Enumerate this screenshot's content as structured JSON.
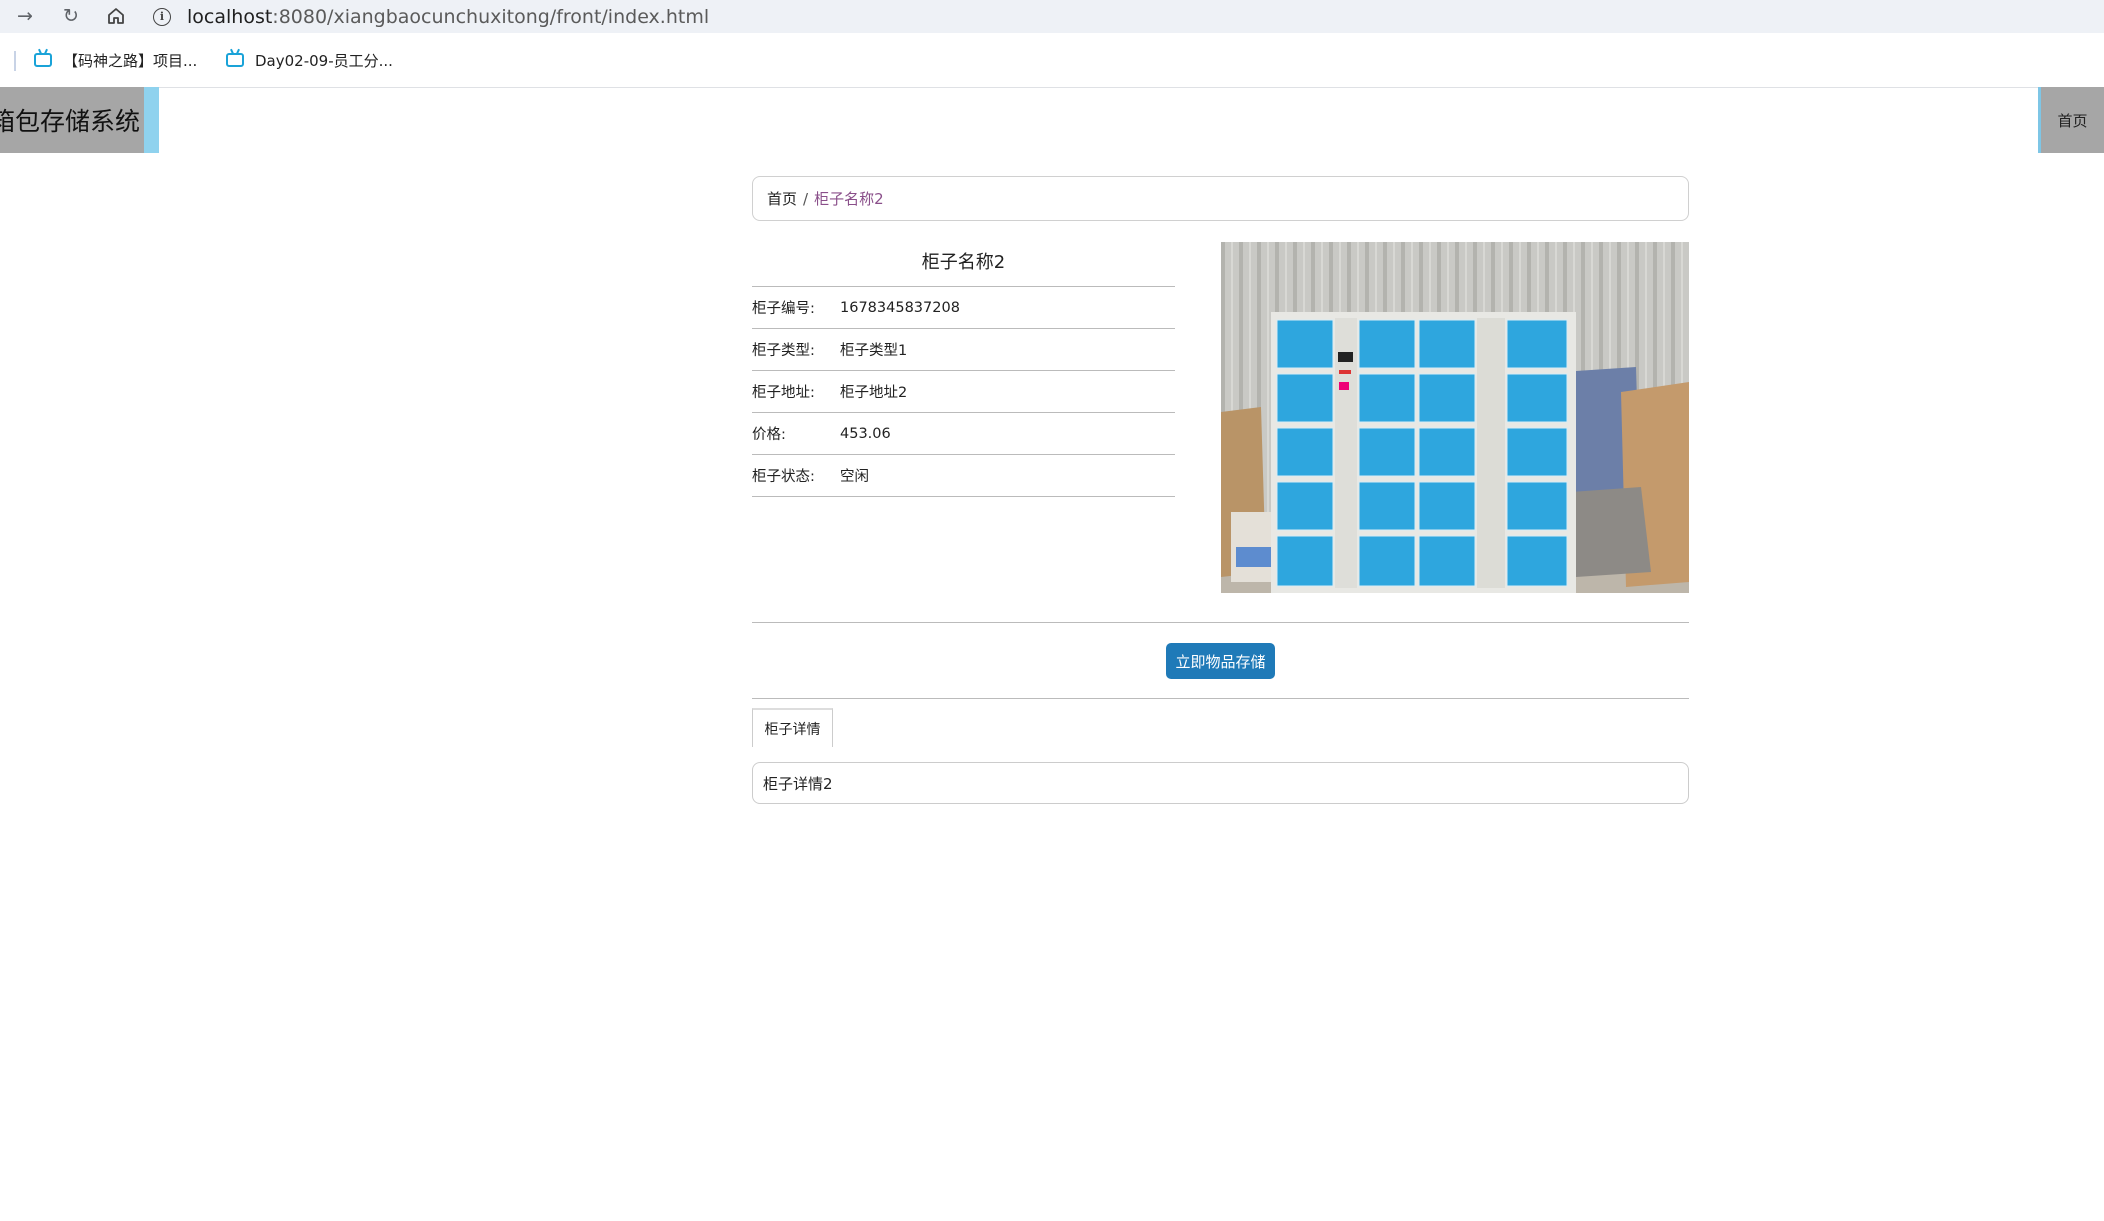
{
  "browser": {
    "url_host": "localhost",
    "url_path": ":8080/xiangbaocunchuxitong/front/index.html",
    "bookmarks": [
      {
        "label": "【码神之路】项目..."
      },
      {
        "label": "Day02-09-员工分..."
      }
    ]
  },
  "header": {
    "logo_text": "箱包存储系统",
    "nav_home": "首页",
    "accent_color": "#8fd2ee"
  },
  "breadcrumb": {
    "home": "首页",
    "separator": "/",
    "current": "柜子名称2"
  },
  "detail": {
    "title": "柜子名称2",
    "rows": [
      {
        "label": "柜子编号:",
        "value": "1678345837208"
      },
      {
        "label": "柜子类型:",
        "value": "柜子类型1"
      },
      {
        "label": "柜子地址:",
        "value": "柜子地址2"
      },
      {
        "label": "价格:",
        "value": "453.06"
      },
      {
        "label": "柜子状态:",
        "value": "空闲"
      }
    ]
  },
  "actions": {
    "store_button": "立即物品存储",
    "button_color": "#1f7ab8"
  },
  "tabs": {
    "detail_tab": "柜子详情",
    "detail_content": "柜子详情2"
  }
}
